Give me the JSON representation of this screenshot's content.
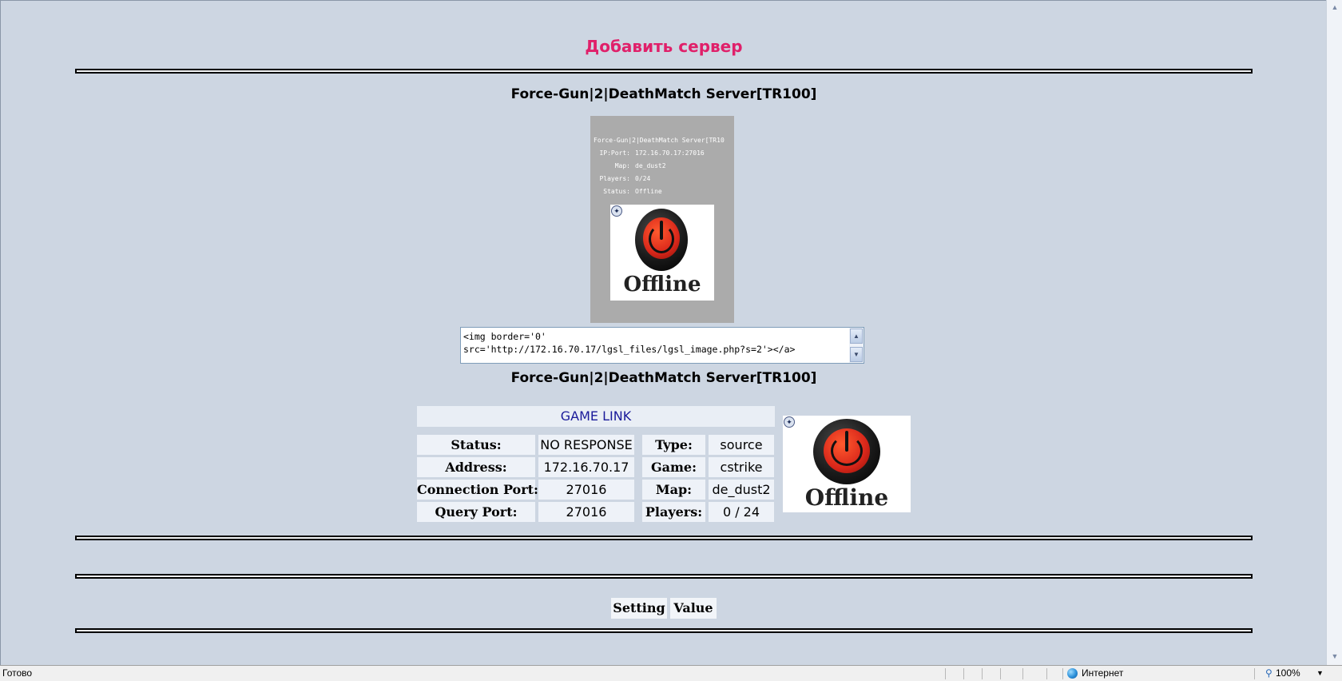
{
  "page": {
    "heading": "Добавить сервер",
    "server_name": "Force-Gun|2|DeathMatch Server[TR100]"
  },
  "banner": {
    "title": "Force-Gun|2|DeathMatch Server[TR10",
    "rows": [
      {
        "key": "IP:Port:",
        "value": "172.16.70.17:27016"
      },
      {
        "key": "Map:",
        "value": "de_dust2"
      },
      {
        "key": "Players:",
        "value": "0/24"
      },
      {
        "key": "Status:",
        "value": "Offline"
      }
    ],
    "status_image_text": "Offline"
  },
  "embed_code": {
    "line1": "<img border='0'",
    "line2": "src='http://172.16.70.17/lgsl_files/lgsl_image.php?s=2'></a>"
  },
  "details": {
    "game_link_label": "GAME LINK",
    "left_rows": [
      {
        "key": "Status:",
        "value": "NO RESPONSE"
      },
      {
        "key": "Address:",
        "value": "172.16.70.17"
      },
      {
        "key": "Connection Port:",
        "value": "27016"
      },
      {
        "key": "Query Port:",
        "value": "27016"
      }
    ],
    "right_rows": [
      {
        "key": "Type:",
        "value": "source"
      },
      {
        "key": "Game:",
        "value": "cstrike"
      },
      {
        "key": "Map:",
        "value": "de_dust2"
      },
      {
        "key": "Players:",
        "value": "0 / 24"
      }
    ],
    "status_image_text": "Offline"
  },
  "settings_table": {
    "headers": [
      "Setting",
      "Value"
    ]
  },
  "statusbar": {
    "status_text": "Готово",
    "zone": "Интернет",
    "zoom": "100%"
  }
}
